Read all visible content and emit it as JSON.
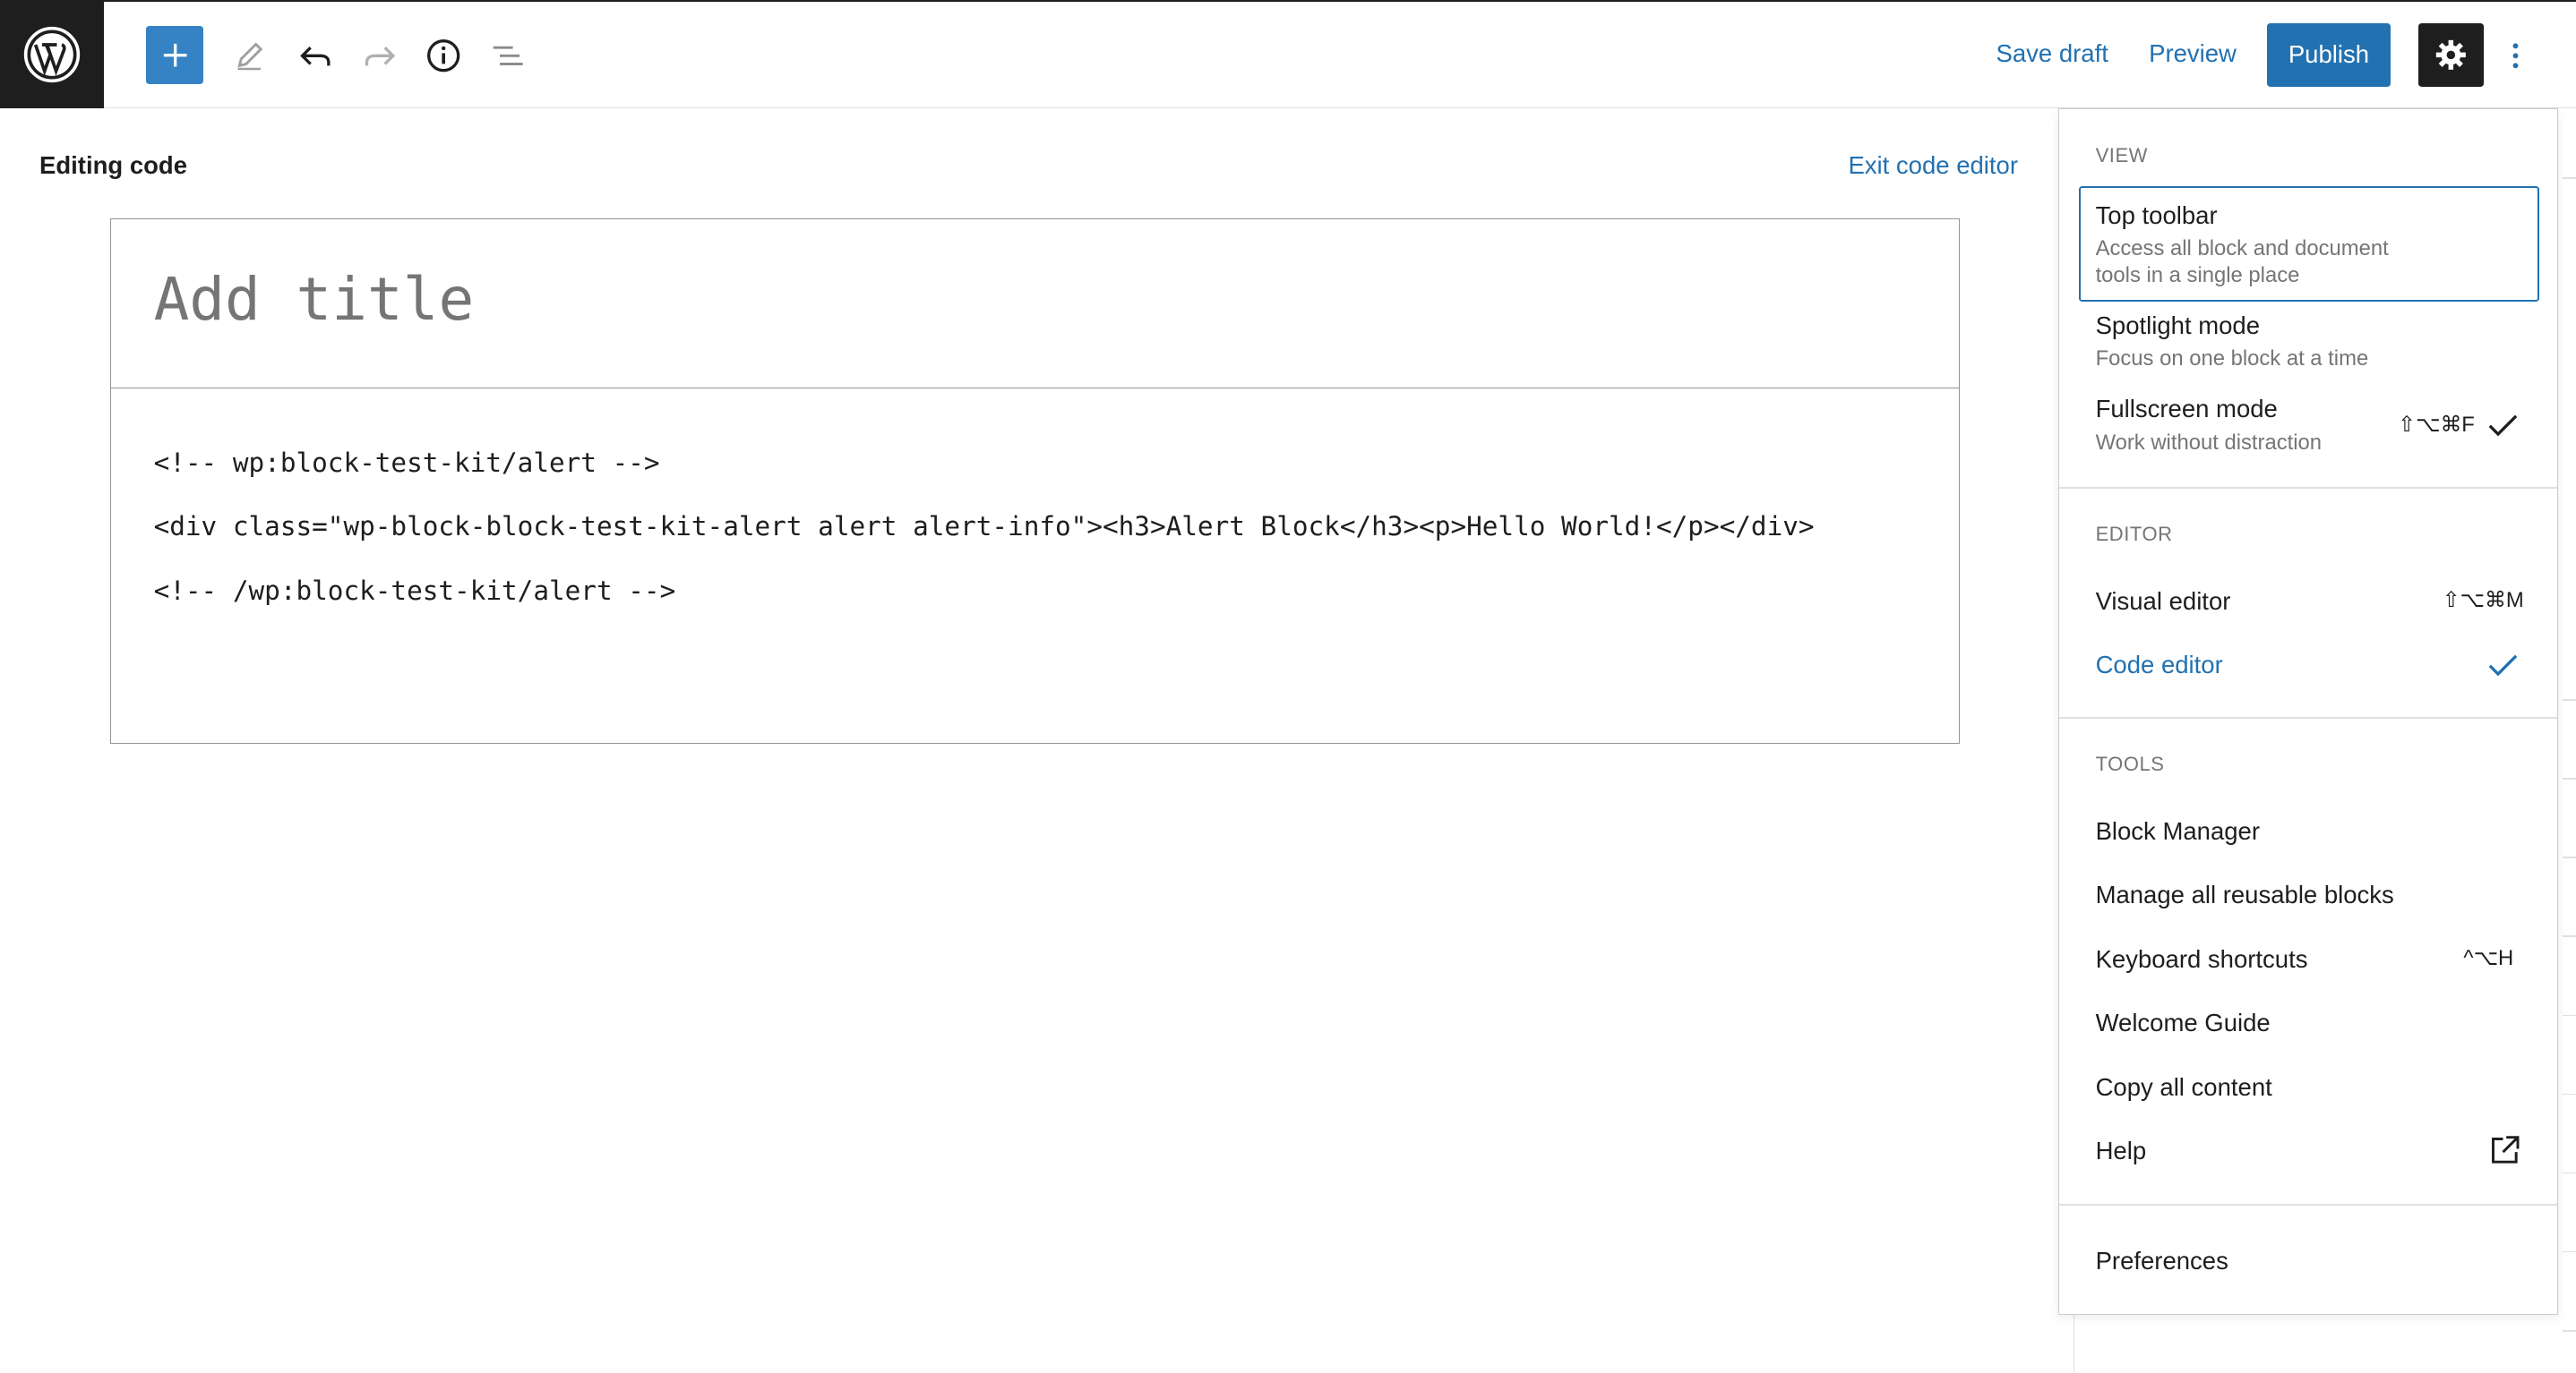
{
  "header": {
    "save_draft": "Save draft",
    "preview": "Preview",
    "publish": "Publish"
  },
  "editor": {
    "mode_label": "Editing code",
    "exit_label": "Exit code editor",
    "title_placeholder": "Add title",
    "code_lines": [
      "<!-- wp:block-test-kit/alert -->",
      "<div class=\"wp-block-block-test-kit-alert alert alert-info\"><h3>Alert Block</h3><p>Hello World!</p></div>",
      "<!-- /wp:block-test-kit/alert -->"
    ]
  },
  "menu": {
    "view": {
      "heading": "VIEW",
      "items": [
        {
          "label": "Top toolbar",
          "desc_line1": "Access all block and document",
          "desc_line2": "tools in a single place"
        },
        {
          "label": "Spotlight mode",
          "desc_line1": "Focus on one block at a time"
        },
        {
          "label": "Fullscreen mode",
          "desc_line1": "Work without distraction",
          "shortcut": "⇧⌥⌘F"
        }
      ]
    },
    "editor": {
      "heading": "EDITOR",
      "items": [
        {
          "label": "Visual editor",
          "shortcut": "⇧⌥⌘M"
        },
        {
          "label": "Code editor"
        }
      ]
    },
    "tools": {
      "heading": "TOOLS",
      "items": [
        {
          "label": "Block Manager"
        },
        {
          "label": "Manage all reusable blocks"
        },
        {
          "label": "Keyboard shortcuts",
          "shortcut": "^⌥H"
        },
        {
          "label": "Welcome Guide"
        },
        {
          "label": "Copy all content"
        },
        {
          "label": "Help"
        }
      ]
    },
    "preferences": "Preferences"
  },
  "colors": {
    "accent": "#2271b1",
    "inserter": "#3582c4",
    "dark": "#1e1e1e"
  },
  "icons": [
    "wordpress-logo-icon",
    "plus-icon",
    "pencil-icon",
    "undo-icon",
    "redo-icon",
    "info-icon",
    "list-view-icon",
    "gear-icon",
    "more-vertical-icon",
    "check-icon",
    "external-link-icon"
  ]
}
